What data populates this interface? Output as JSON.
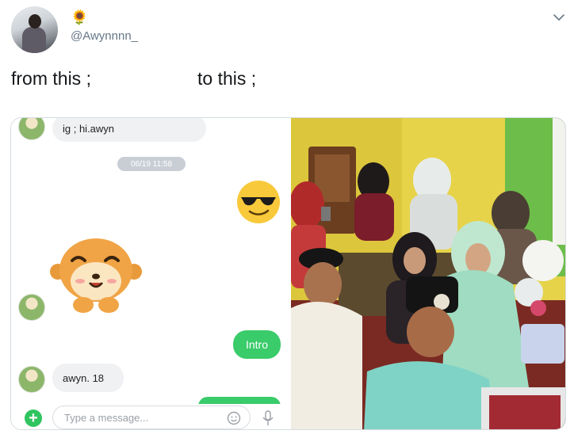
{
  "tweet": {
    "display_name": "🌻",
    "handle": "@Awynnnn_",
    "text_left": "from this ;",
    "text_right": "to this ;"
  },
  "chat": {
    "first_message": "ig ; hi.awyn",
    "timestamp": "06/19 11:58",
    "outgoing_message": "Intro",
    "incoming_message": "awyn. 18",
    "input_placeholder": "Type a message..."
  },
  "colors": {
    "outgoing_bubble": "#3acb6a",
    "incoming_bubble": "#f0f1f3",
    "handle_gray": "#657786"
  },
  "icons": [
    "chevron-down-icon",
    "sunglasses-emoji-icon",
    "monkey-sticker-icon",
    "plus-icon",
    "smiley-icon",
    "microphone-icon"
  ]
}
